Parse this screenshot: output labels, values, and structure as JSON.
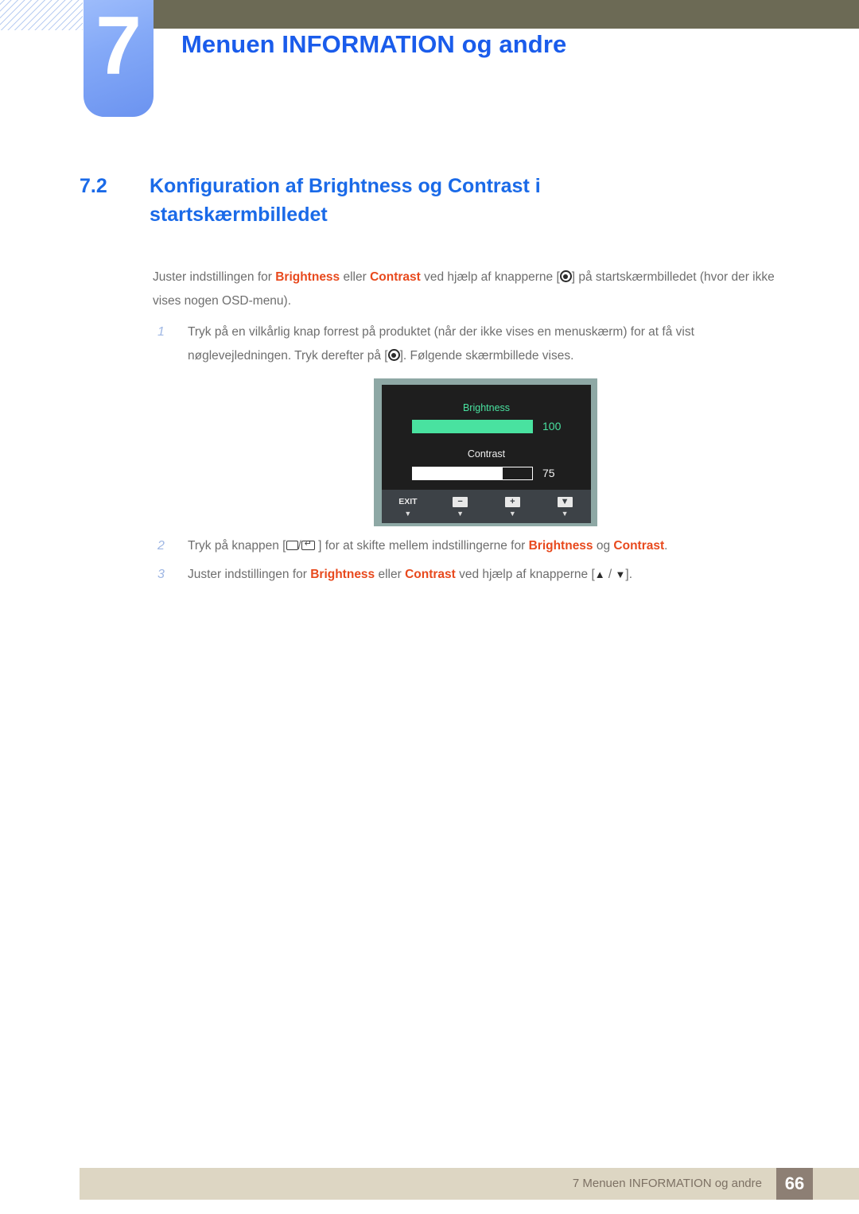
{
  "chapter": {
    "number": "7",
    "title": "Menuen INFORMATION og andre"
  },
  "section": {
    "number": "7.2",
    "title": "Konfiguration af Brightness og Contrast i startskærmbilledet"
  },
  "intro": {
    "part1": "Juster indstillingen for ",
    "hl1": "Brightness",
    "part2": " eller ",
    "hl2": "Contrast",
    "part3": " ved hjælp af knapperne [",
    "part4": "] på startskærmbilledet (hvor der ikke vises nogen OSD-menu)."
  },
  "steps": [
    {
      "num": "1",
      "part1": "Tryk på en vilkårlig knap forrest på produktet (når der ikke vises en menuskærm) for at få vist nøglevejledningen. Tryk derefter på [",
      "part2": "]. Følgende skærmbillede vises."
    },
    {
      "num": "2",
      "part1": "Tryk på knappen [",
      "sep": "/",
      "part2": " ] for at skifte mellem indstillingerne for ",
      "hl1": "Brightness",
      "part3": " og ",
      "hl2": "Contrast",
      "part4": "."
    },
    {
      "num": "3",
      "part1": "Juster indstillingen for ",
      "hl1": "Brightness",
      "part2": " eller ",
      "hl2": "Contrast",
      "part3": " ved hjælp af knapperne [",
      "up": "▲",
      "sep": " / ",
      "down": "▼",
      "part4": "]."
    }
  ],
  "osd": {
    "brightness_label": "Brightness",
    "brightness_value": "100",
    "brightness_percent": 100,
    "contrast_label": "Contrast",
    "contrast_value": "75",
    "contrast_percent": 75,
    "footer_buttons": [
      {
        "name": "exit",
        "glyph": "EXIT",
        "type": "text",
        "caret": "▼"
      },
      {
        "name": "minus",
        "glyph": "−",
        "type": "box",
        "caret": "▼"
      },
      {
        "name": "plus",
        "glyph": "+",
        "type": "box",
        "caret": "▼"
      },
      {
        "name": "down",
        "glyph": "▼",
        "type": "box",
        "caret": "▼"
      }
    ],
    "colors": {
      "bezel": "#8ea8a5",
      "screen": "#1e1e1e",
      "accent_green": "#49e2a0",
      "footer": "#3d4247"
    }
  },
  "footer": {
    "text": "7 Menuen INFORMATION og andre",
    "page": "66"
  },
  "colors": {
    "heading_blue": "#1a6ae8",
    "badge_blue": "#84a9f7",
    "topbar": "#6c6a55",
    "highlight_orange": "#e8491d",
    "body_gray": "#6e6e6e",
    "footer_bar": "#ddd6c3",
    "footer_page_box": "#8d7f74"
  }
}
